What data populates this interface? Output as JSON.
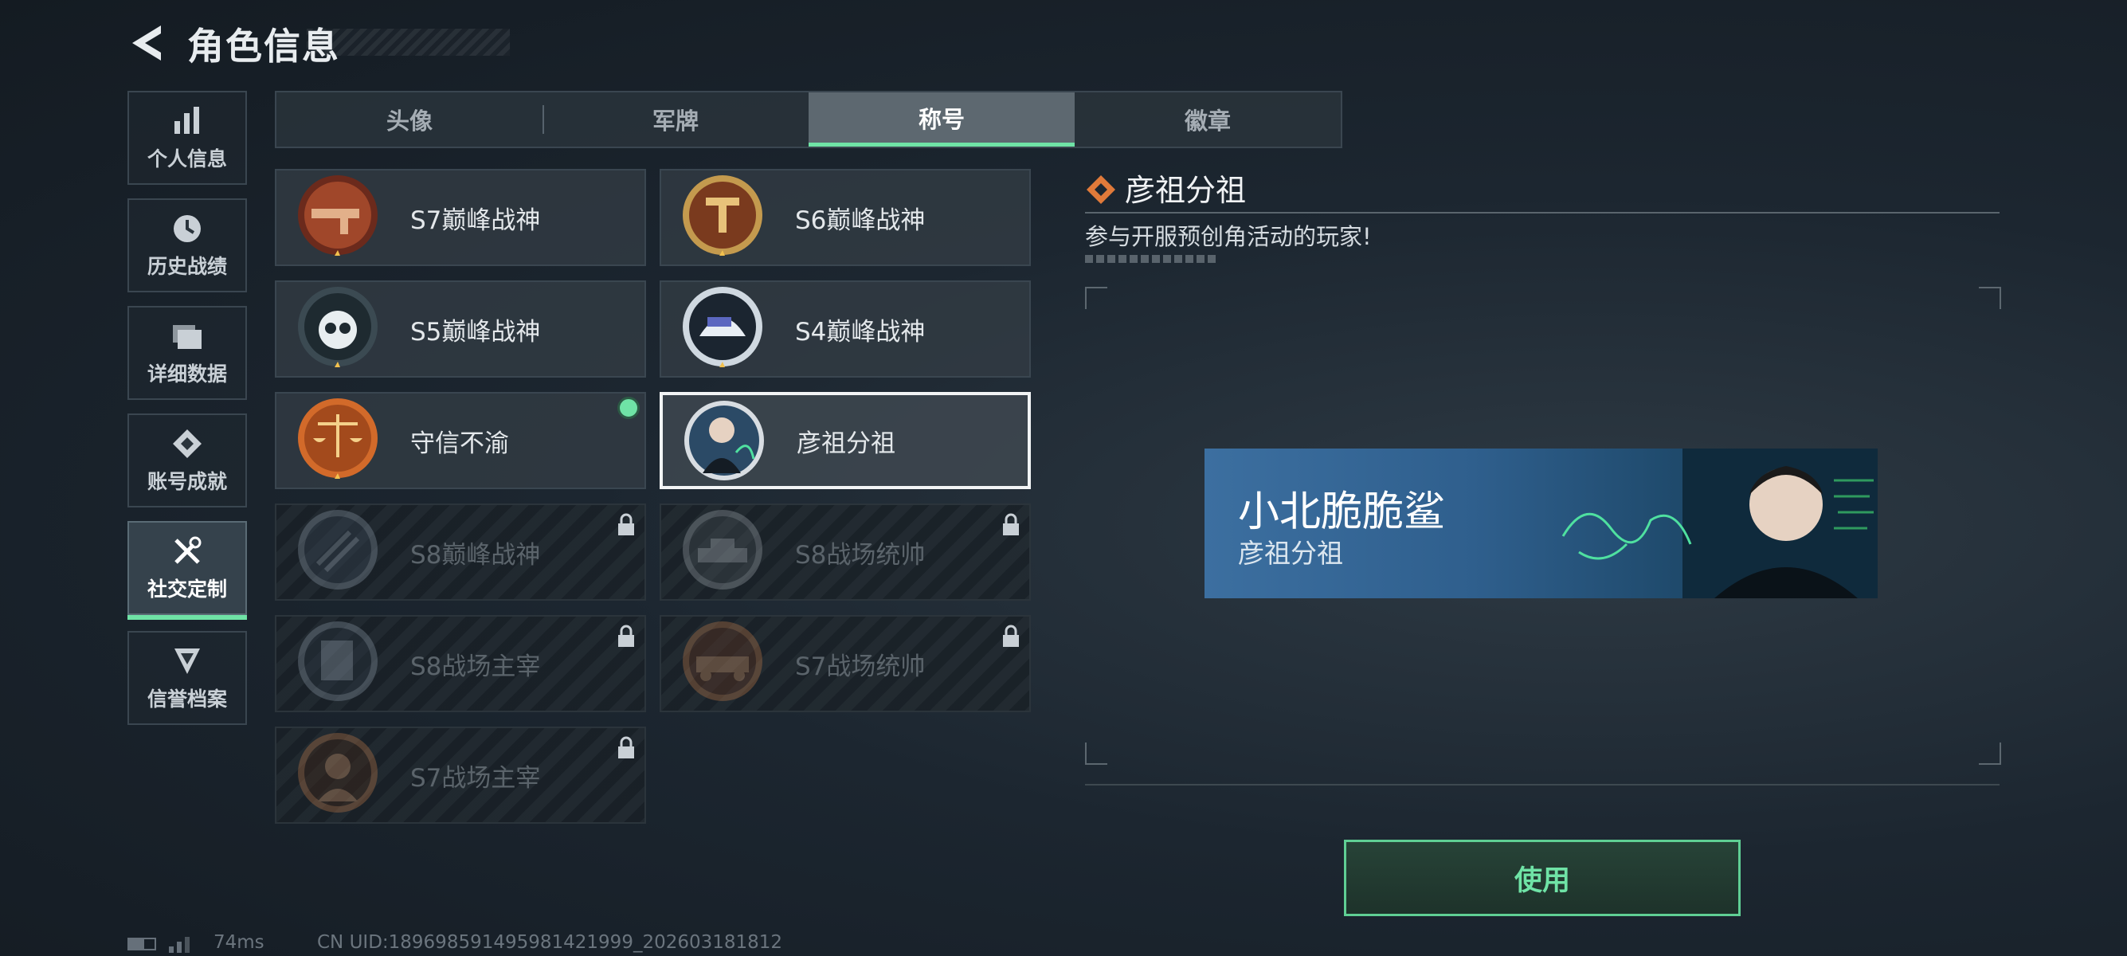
{
  "header": {
    "title": "角色信息"
  },
  "sidebar": {
    "items": [
      {
        "label": "个人信息",
        "icon": "bar-chart-icon"
      },
      {
        "label": "历史战绩",
        "icon": "clock-icon"
      },
      {
        "label": "详细数据",
        "icon": "folders-icon"
      },
      {
        "label": "账号成就",
        "icon": "achievement-icon"
      },
      {
        "label": "社交定制",
        "icon": "tools-icon",
        "active": true
      },
      {
        "label": "信誉档案",
        "icon": "shield-chevron-icon"
      }
    ]
  },
  "tabs": [
    {
      "label": "头像"
    },
    {
      "label": "军牌"
    },
    {
      "label": "称号",
      "active": true
    },
    {
      "label": "徽章"
    }
  ],
  "titles": [
    {
      "name": "S7巅峰战神",
      "locked": false
    },
    {
      "name": "S6巅峰战神",
      "locked": false
    },
    {
      "name": "S5巅峰战神",
      "locked": false
    },
    {
      "name": "S4巅峰战神",
      "locked": false
    },
    {
      "name": "守信不渝",
      "locked": false,
      "equipped": true
    },
    {
      "name": "彦祖分祖",
      "locked": false,
      "selected": true
    },
    {
      "name": "S8巅峰战神",
      "locked": true
    },
    {
      "name": "S8战场统帅",
      "locked": true
    },
    {
      "name": "S8战场主宰",
      "locked": true
    },
    {
      "name": "S7战场统帅",
      "locked": true
    },
    {
      "name": "S7战场主宰",
      "locked": true
    }
  ],
  "detail": {
    "title": "彦祖分祖",
    "description": "参与开服预创角活动的玩家!"
  },
  "nameplate": {
    "player_name": "小北脆脆鲨",
    "title": "彦祖分祖"
  },
  "use_button": {
    "label": "使用"
  },
  "footer": {
    "ping": "74ms",
    "uid": "CN UID:1896985914959814219​99_202603181812"
  },
  "colors": {
    "accent": "#6fe3a6",
    "background": "#1c2630"
  }
}
